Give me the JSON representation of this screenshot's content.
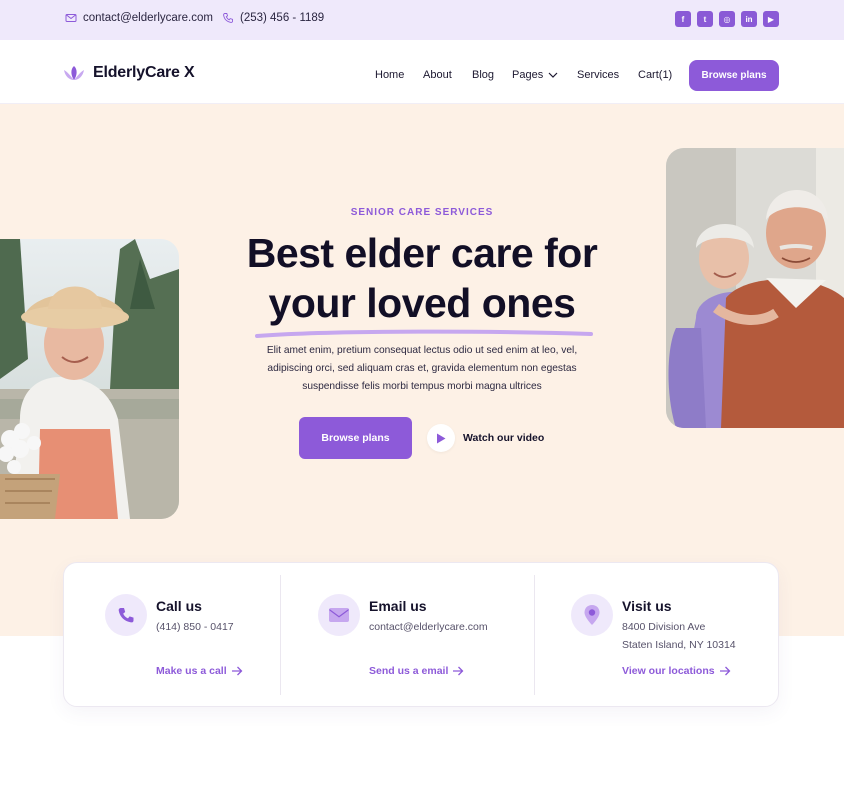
{
  "topbar": {
    "email": "contact@elderlycare.com",
    "phone": "(253) 456 - 1189",
    "socials": [
      {
        "icon": "facebook-icon",
        "glyph": "f"
      },
      {
        "icon": "twitter-icon",
        "glyph": "t"
      },
      {
        "icon": "instagram-icon",
        "glyph": "◎"
      },
      {
        "icon": "linkedin-icon",
        "glyph": "in"
      },
      {
        "icon": "youtube-icon",
        "glyph": "▶"
      }
    ]
  },
  "header": {
    "brand": "ElderlyCare X",
    "nav": [
      "Home",
      "About",
      "Blog",
      "Pages",
      "Services",
      "Cart(1)"
    ],
    "cta": "Browse plans"
  },
  "hero": {
    "eyebrow": "SENIOR CARE SERVICES",
    "headline_line1": "Best elder care for",
    "headline_line2": "your loved ones",
    "lede": "Elit amet enim, pretium consequat lectus odio ut sed enim at leo, vel, adipiscing orci, sed aliquam cras et, gravida elementum non egestas suspendisse felis morbi tempus morbi magna ultrices",
    "primary_button": "Browse plans",
    "video_link": "Watch our video"
  },
  "contact_cards": [
    {
      "icon": "phone-icon",
      "title": "Call us",
      "lines": [
        "(414) 850 - 0417"
      ],
      "link": "Make us a call"
    },
    {
      "icon": "mail-icon",
      "title": "Email us",
      "lines": [
        "contact@elderlycare.com"
      ],
      "link": "Send us a email"
    },
    {
      "icon": "location-pin-icon",
      "title": "Visit us",
      "lines": [
        "8400 Division Ave",
        "Staten Island, NY 10314"
      ],
      "link": "View our locations"
    }
  ],
  "colors": {
    "accent": "#8d5ad9",
    "hero_bg": "#fdf1e6",
    "topbar_bg": "#efe9fb"
  }
}
